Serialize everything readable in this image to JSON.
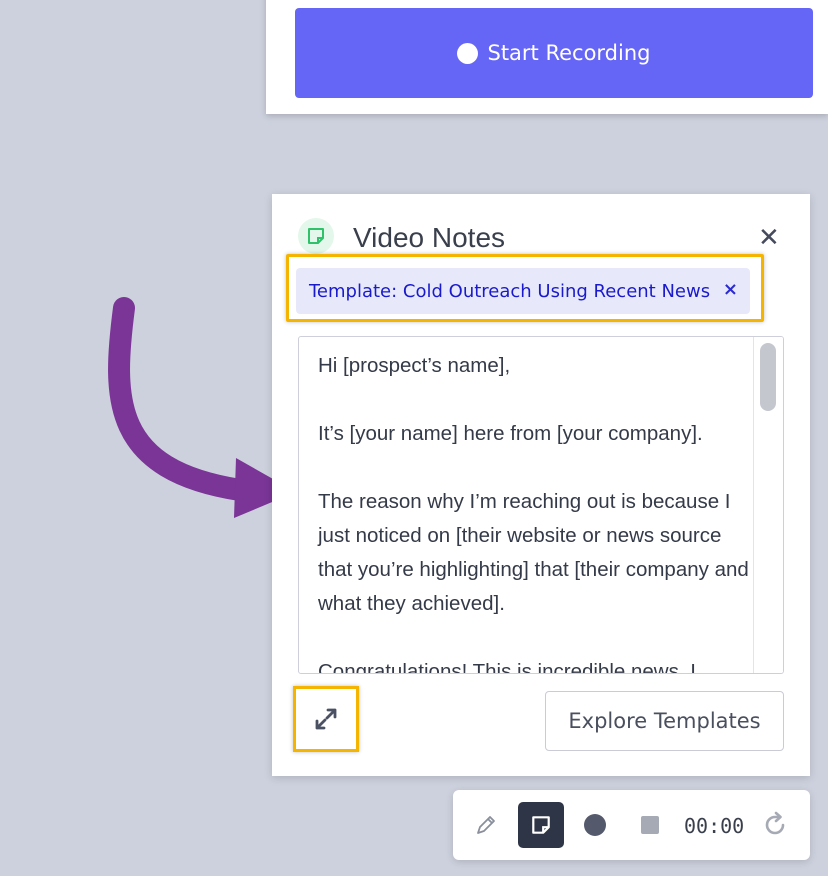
{
  "recorder": {
    "start_label": "Start Recording",
    "accent": "#6565f6"
  },
  "notes": {
    "title": "Video Notes",
    "icon": "note-icon",
    "close_icon": "close-icon",
    "template_label": "Template: Cold Outreach Using Recent News",
    "template_remove": "×",
    "body": [
      "Hi [prospect’s name],",
      "It’s [your name] here from [your company].",
      "The reason why I’m reaching out is because I just noticed on [their website or news source that you’re highlighting] that [their company and what they achieved].",
      "Congratulations! This is incredible news. I"
    ],
    "expand_icon": "expand-arrows-icon",
    "explore_label": "Explore Templates"
  },
  "toolbar": {
    "timer": "00:00",
    "icons": [
      "pencil-icon",
      "note-icon",
      "record-dot-icon",
      "stop-square-icon",
      "refresh-icon"
    ]
  },
  "annotation": {
    "arrow_color": "#7a3596",
    "highlight_color": "#f4b400"
  }
}
